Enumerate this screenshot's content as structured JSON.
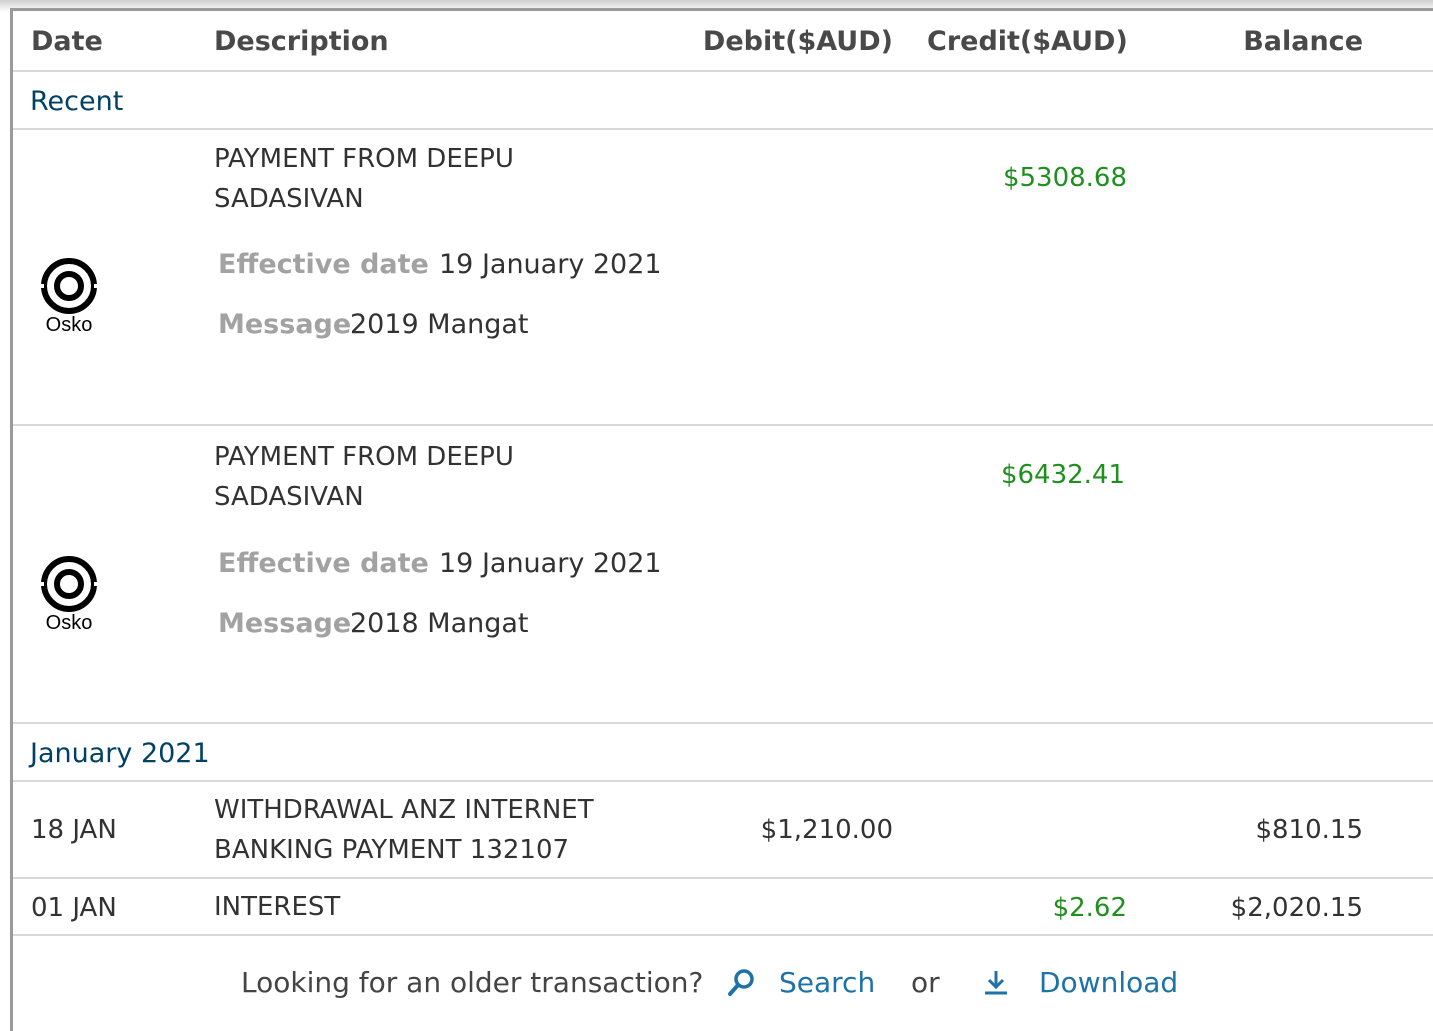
{
  "header": {
    "date": "Date",
    "description": "Description",
    "debit": "Debit($AUD)",
    "credit": "Credit($AUD)",
    "balance": "Balance"
  },
  "sections": {
    "recent": "Recent",
    "january": "January 2021"
  },
  "pending": [
    {
      "logo_label": "Osko",
      "description_line1": "PAYMENT FROM DEEPU",
      "description_line2": "SADASIVAN",
      "credit": "$5308.68",
      "effective_label": "Effective date",
      "effective_value": "19 January 2021",
      "message_label": "Message",
      "message_value": "2019 Mangat"
    },
    {
      "logo_label": "Osko",
      "description_line1": "PAYMENT FROM DEEPU",
      "description_line2": "SADASIVAN",
      "credit": "$6432.41",
      "effective_label": "Effective date",
      "effective_value": "19 January 2021",
      "message_label": "Message",
      "message_value": "2018 Mangat"
    }
  ],
  "transactions": [
    {
      "date": "18 JAN",
      "description_line1": "WITHDRAWAL ANZ INTERNET",
      "description_line2": "BANKING PAYMENT 132107",
      "debit": "$1,210.00",
      "credit": "",
      "balance": "$810.15"
    },
    {
      "date": "01 JAN",
      "description_line1": "INTEREST",
      "description_line2": "",
      "debit": "",
      "credit": "$2.62",
      "balance": "$2,020.15"
    }
  ],
  "footer": {
    "prompt": "Looking for an older transaction?",
    "search_label": "Search",
    "or": "or",
    "download_label": "Download"
  },
  "colors": {
    "credit": "#1f8f1f",
    "section": "#004165",
    "link": "#1d73a8"
  },
  "icons": {
    "search": "search-icon",
    "download": "download-icon",
    "osko": "osko-logo-icon"
  }
}
